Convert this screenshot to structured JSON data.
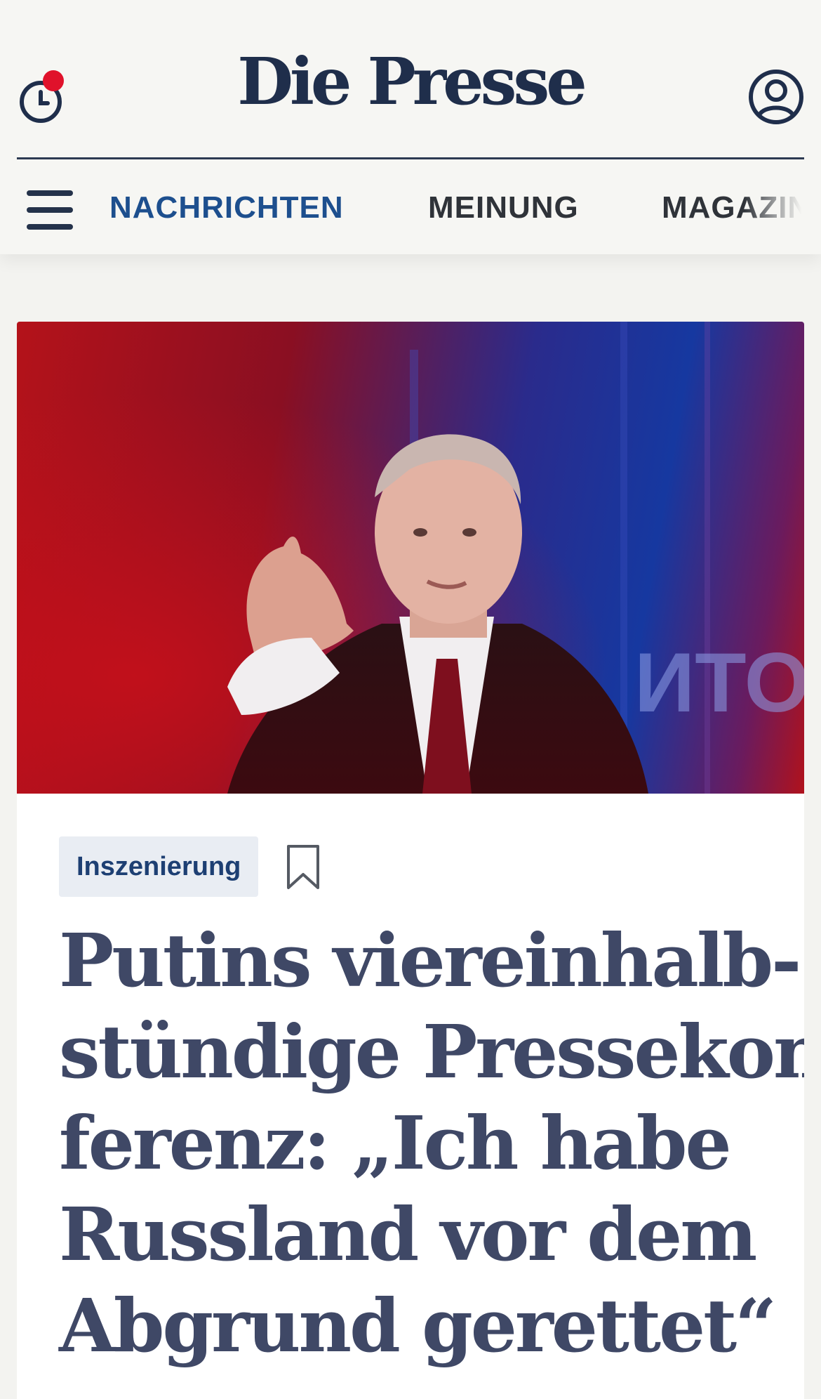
{
  "header": {
    "logo": "Die Presse",
    "history_button": "history-clock-icon",
    "account_button": "user-account-icon",
    "notification_color": "#e0122b"
  },
  "nav": {
    "items": [
      {
        "label": "NACHRICHTEN",
        "active": true
      },
      {
        "label": "MEINUNG",
        "active": false
      },
      {
        "label": "MAGAZIN",
        "active": false
      }
    ]
  },
  "article": {
    "tag": "Inszenierung",
    "headline_lines": [
      "Putins viereinhalb-",
      "stündige Pressekon-",
      "ferenz: „Ich habe",
      "Russland vor dem",
      "Abgrund gerettet“"
    ],
    "backdrop_text": "ИТО"
  },
  "colors": {
    "brand": "#1f2e4b",
    "active_nav": "#1d4f8e",
    "headline": "#3f4866",
    "tag_bg": "#e9edf3"
  }
}
